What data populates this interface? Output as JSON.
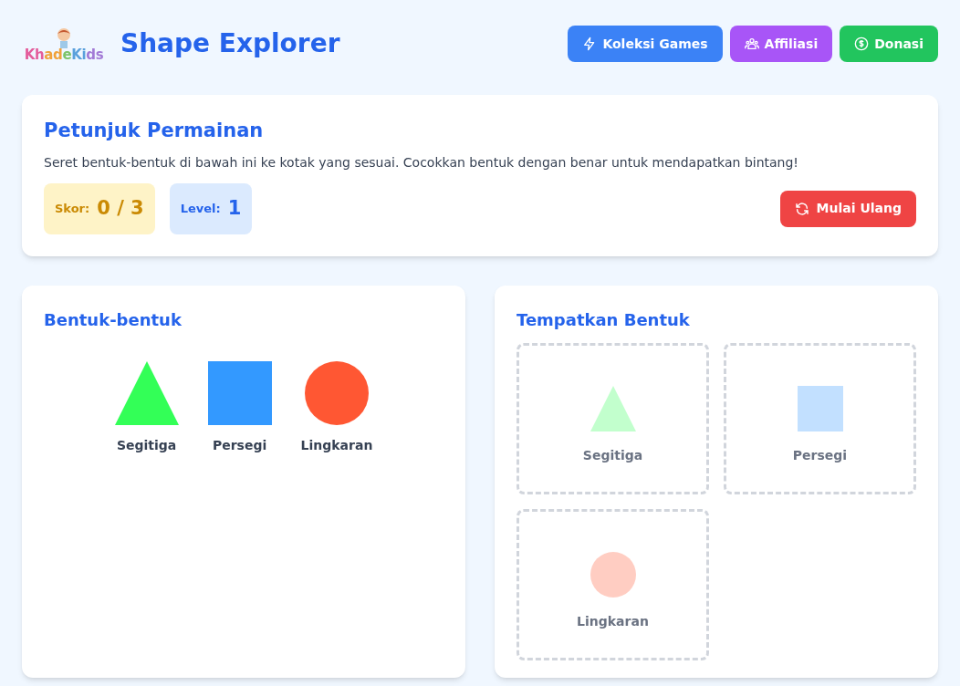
{
  "header": {
    "logo_text": "KhadeKids",
    "title": "Shape Explorer",
    "buttons": [
      {
        "kind": "bolt",
        "label": "Koleksi Games",
        "color": "#3b82f6"
      },
      {
        "kind": "users",
        "label": "Affiliasi",
        "color": "#a855f7"
      },
      {
        "kind": "dollar",
        "label": "Donasi",
        "color": "#22c55e"
      }
    ]
  },
  "instructions": {
    "title": "Petunjuk Permainan",
    "text": "Seret bentuk-bentuk di bawah ini ke kotak yang sesuai. Cocokkan bentuk dengan benar untuk mendapatkan bintang!",
    "score_label": "Skor:",
    "score": "0",
    "separator": "/",
    "total": "3",
    "level_label": "Level:",
    "level": "1",
    "restart": "Mulai Ulang"
  },
  "shapes_panel": {
    "title": "Bentuk-bentuk",
    "shapes": [
      {
        "kind": "triangle",
        "label": "Segitiga",
        "color": "#33ff57"
      },
      {
        "kind": "square",
        "label": "Persegi",
        "color": "#3399ff"
      },
      {
        "kind": "circle",
        "label": "Lingkaran",
        "color": "#ff5733"
      }
    ]
  },
  "targets_panel": {
    "title": "Tempatkan Bentuk",
    "targets": [
      {
        "kind": "triangle",
        "label": "Segitiga",
        "color": "#c2ffcd"
      },
      {
        "kind": "square",
        "label": "Persegi",
        "color": "#c2e0ff"
      },
      {
        "kind": "circle",
        "label": "Lingkaran",
        "color": "#ffcdc2"
      }
    ]
  }
}
